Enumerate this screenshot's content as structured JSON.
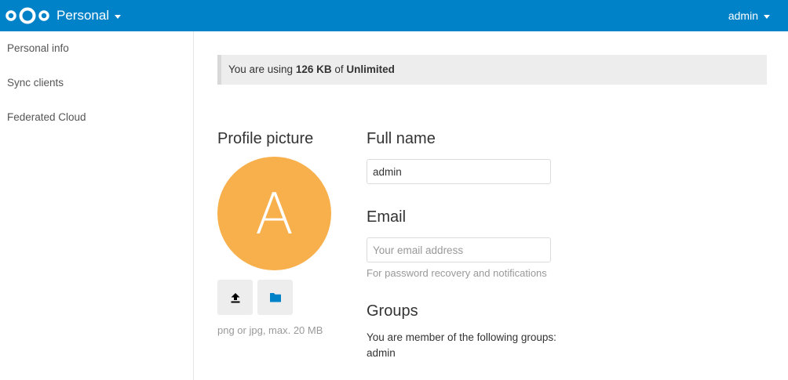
{
  "header": {
    "app_name": "Personal",
    "user_name": "admin",
    "brand_color": "#0082c9"
  },
  "sidebar": {
    "items": [
      {
        "label": "Personal info"
      },
      {
        "label": "Sync clients"
      },
      {
        "label": "Federated Cloud"
      }
    ]
  },
  "quota": {
    "prefix": "You are using ",
    "used": "126 KB",
    "middle": " of ",
    "total": "Unlimited"
  },
  "profile_picture": {
    "title": "Profile picture",
    "avatar_letter": "A",
    "avatar_color": "#f8b04d",
    "upload_icon": "upload-icon",
    "folder_icon": "folder-icon",
    "hint": "png or jpg, max. 20 MB"
  },
  "full_name": {
    "title": "Full name",
    "value": "admin"
  },
  "email": {
    "title": "Email",
    "value": "",
    "placeholder": "Your email address",
    "hint": "For password recovery and notifications"
  },
  "groups": {
    "title": "Groups",
    "description": "You are member of the following groups:",
    "list": "admin"
  }
}
